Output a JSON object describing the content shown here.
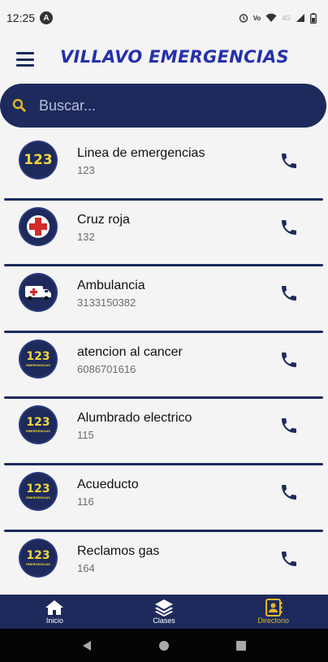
{
  "status_bar": {
    "time": "12:25",
    "icons": [
      "alarm-icon",
      "volte-icon",
      "wifi-icon",
      "signal-icon",
      "battery-icon"
    ]
  },
  "app": {
    "title": "VILLAVO EMERGENCIAS"
  },
  "search": {
    "placeholder": "Buscar..."
  },
  "contacts": [
    {
      "name": "Linea de emergencias",
      "number": "123",
      "icon": "badge-123"
    },
    {
      "name": "Cruz roja",
      "number": "132",
      "icon": "red-cross"
    },
    {
      "name": "Ambulancia",
      "number": "3133150382",
      "icon": "ambulance"
    },
    {
      "name": "atencion al cancer",
      "number": "6086701616",
      "icon": "badge-123-emergencias"
    },
    {
      "name": "Alumbrado electrico",
      "number": "115",
      "icon": "badge-123-emergencias"
    },
    {
      "name": "Acueducto",
      "number": "116",
      "icon": "badge-123-emergencias"
    },
    {
      "name": "Reclamos gas",
      "number": "164",
      "icon": "badge-123-emergencias"
    }
  ],
  "badge": {
    "big": "123",
    "small_num": "123",
    "small_sub": "EMERGENCIAS"
  },
  "nav": [
    {
      "label": "Inicio",
      "icon": "home-icon",
      "active": false
    },
    {
      "label": "Clases",
      "icon": "layers-icon",
      "active": false
    },
    {
      "label": "Directorio",
      "icon": "contacts-book-icon",
      "active": true
    }
  ],
  "colors": {
    "navy": "#1d2a5b",
    "title": "#2531a8",
    "badge_yellow": "#f2d53c",
    "active": "#e0b72a"
  }
}
